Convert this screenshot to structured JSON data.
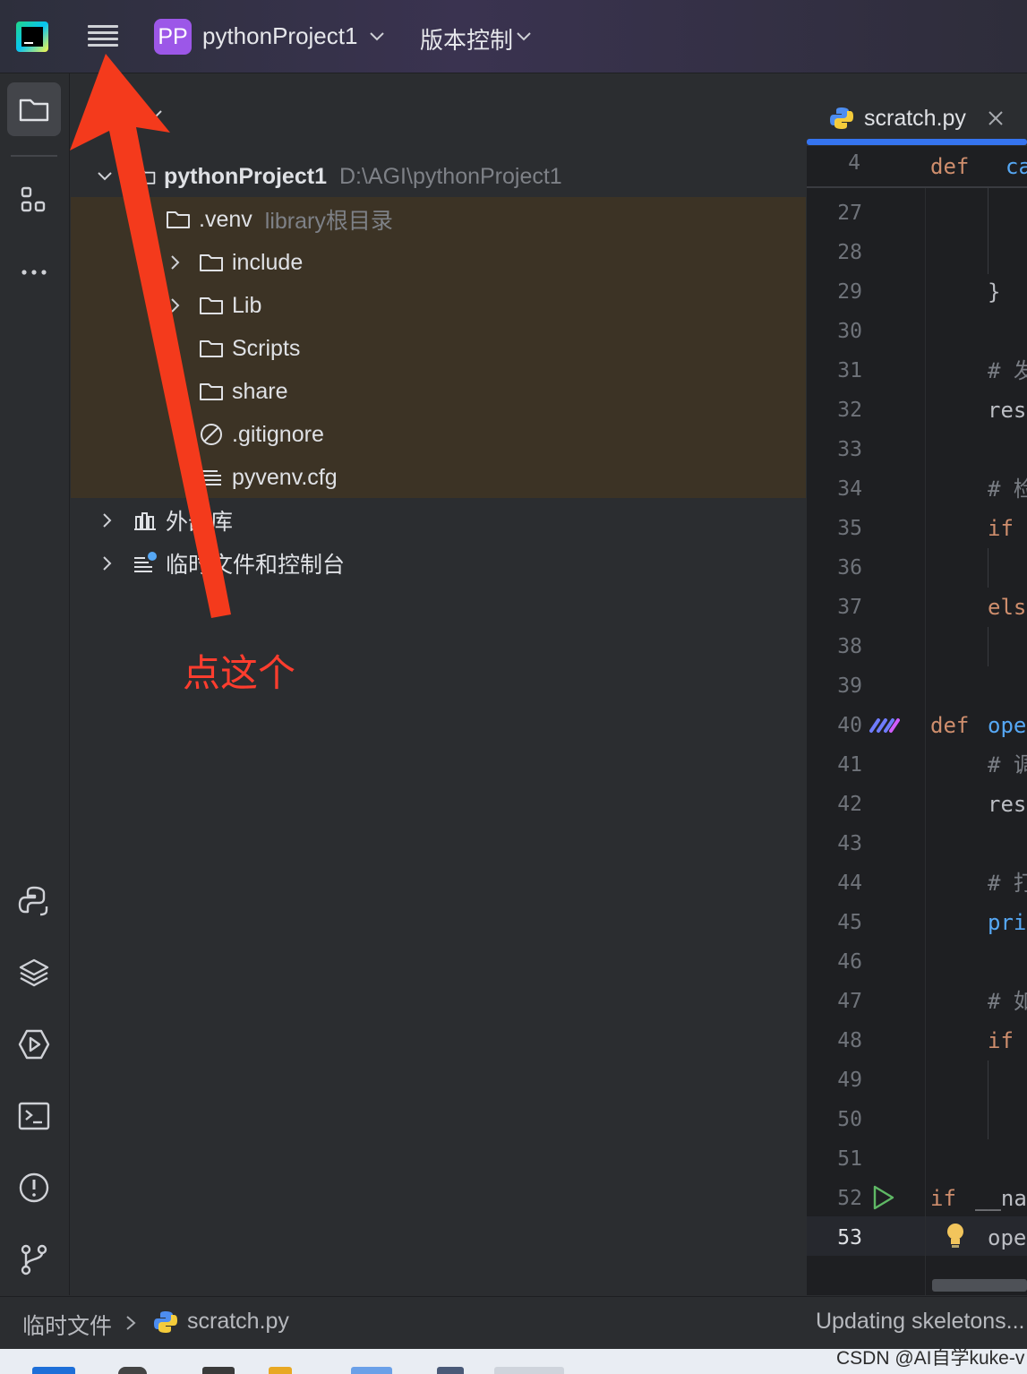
{
  "titlebar": {
    "project_badge": "PP",
    "project_name": "pythonProject1",
    "vcs_label": "版本控制",
    "logo_text": "PC"
  },
  "toolstrip": {
    "top": [
      "folder-icon",
      "structure-icon",
      "more-icon"
    ],
    "bottom": [
      "python-packages-icon",
      "layers-icon",
      "services-icon",
      "terminal-icon",
      "problems-icon",
      "git-icon"
    ]
  },
  "tree": {
    "root_name": "pythonProject1",
    "root_path": "D:\\AGI\\pythonProject1",
    "venv_name": ".venv",
    "venv_note": "library根目录",
    "children": [
      "include",
      "Lib",
      "Scripts",
      "share",
      ".gitignore",
      "pyvenv.cfg"
    ],
    "external_libs": "外部库",
    "scratches": "临时文件和控制台"
  },
  "editor": {
    "tab_label": "scratch.py",
    "sticky_line_number": "4",
    "sticky_kw": "def",
    "sticky_fn": "cal",
    "line_numbers": [
      "27",
      "28",
      "29",
      "30",
      "31",
      "32",
      "33",
      "34",
      "35",
      "36",
      "37",
      "38",
      "39",
      "40",
      "41",
      "42",
      "43",
      "44",
      "45",
      "46",
      "47",
      "48",
      "49",
      "50",
      "51",
      "52",
      "53"
    ],
    "code": {
      "l29": "}",
      "l31": "# 发",
      "l32": "res",
      "l34": "# 检",
      "l35_kw": "if",
      "l37_kw": "els",
      "l40_kw": "def",
      "l40_fn": "ope",
      "l41": "# 调",
      "l42": "res",
      "l44": "# 打",
      "l45": "pri",
      "l47": "# 如",
      "l48_kw": "if",
      "l52_kw": "if",
      "l52_rest": "__na",
      "l53": "ope"
    }
  },
  "statusbar": {
    "crumb_root": "临时文件",
    "crumb_file": "scratch.py",
    "status": "Updating skeletons..."
  },
  "annotation": {
    "text": "点这个",
    "color": "#ff3d2e"
  },
  "watermark": "CSDN @AI自学kuke-v",
  "colors": {
    "accent": "#3574f0",
    "keyword": "#cf8e6d",
    "function": "#56a8f5",
    "project_badge": "#9c57e8",
    "venv_highlight": "#3c3325"
  }
}
